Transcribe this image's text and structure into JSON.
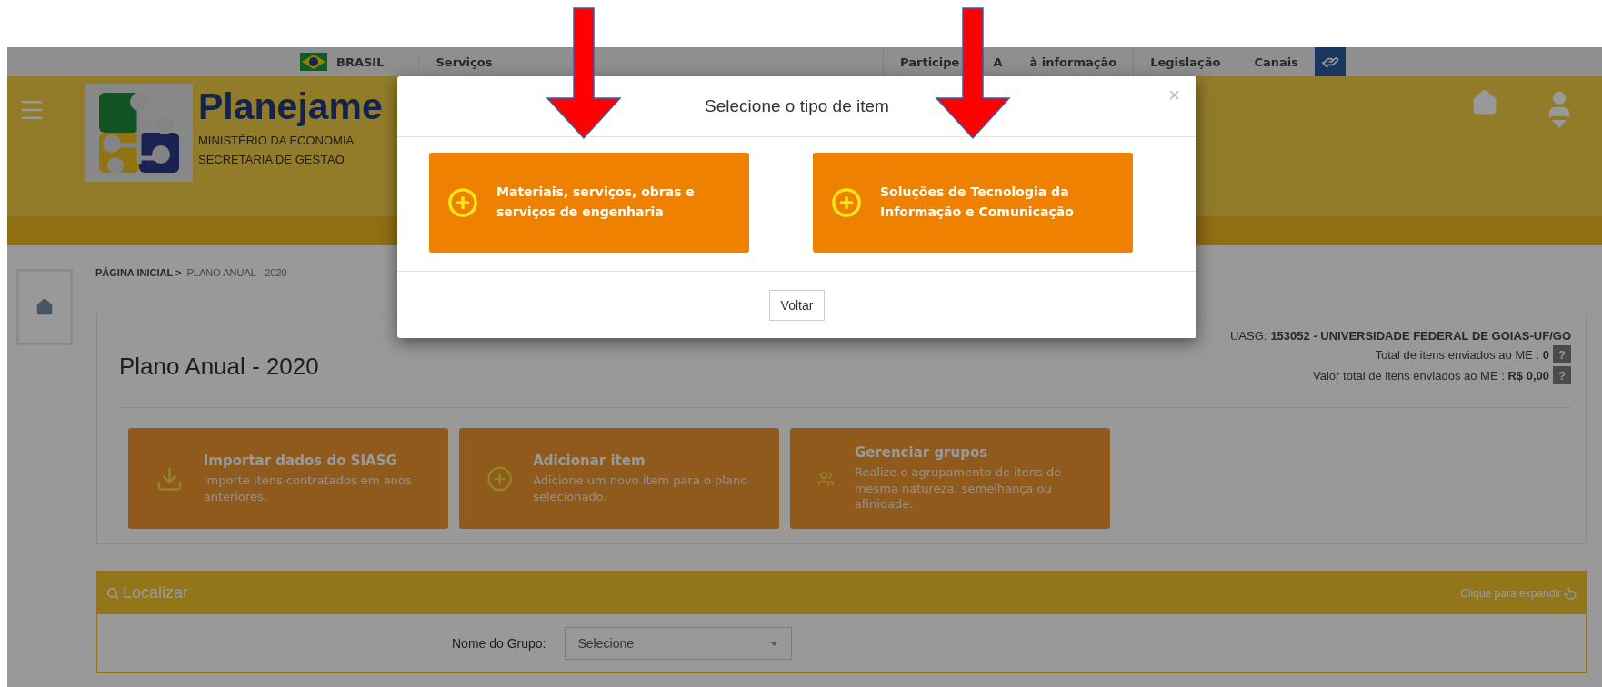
{
  "gov_bar": {
    "country": "BRASIL",
    "left_links": [
      "Serviços"
    ],
    "right_links": [
      {
        "parts": [
          "Participe"
        ]
      },
      {
        "parts": [
          "A",
          "à informação"
        ]
      },
      {
        "parts": [
          "Legislação"
        ]
      },
      {
        "parts": [
          "Canais"
        ]
      }
    ]
  },
  "header": {
    "title": "Planejame",
    "subtitle_lines": [
      "MINISTÉRIO DA ECONOMIA",
      "SECRETARIA DE GESTÃO"
    ]
  },
  "breadcrumb": [
    {
      "label": "PÁGINA INICIAL >",
      "current": false
    },
    {
      "label": "PLANO ANUAL - 2020",
      "current": true
    }
  ],
  "page_title": "Plano Anual - 2020",
  "info": {
    "uasg_label": "UASG:",
    "uasg_value": "153052 - UNIVERSIDADE FEDERAL DE GOIAS-UF/GO",
    "rows": [
      {
        "label": "Total de itens enviados ao ME :",
        "value": "0",
        "help": "?"
      },
      {
        "label": "Valor total de itens enviados ao ME :",
        "value": "R$ 0,00",
        "help": "?"
      }
    ]
  },
  "actions": [
    {
      "kind": "import",
      "title": "Importar dados do SIASG",
      "description": "Importe itens contratados em anos anteriores."
    },
    {
      "kind": "add",
      "title": "Adicionar item",
      "description": "Adicione um novo item para o plano selecionado."
    },
    {
      "kind": "groups",
      "title": "Gerenciar grupos",
      "description": "Realize o agrupamento de itens de mesma natureza, semelhança ou afinidade."
    }
  ],
  "search_panel": {
    "title": "Localizar",
    "hint": "Clique para expandir",
    "fields": [
      {
        "label": "Nome do Grupo:",
        "value": "Selecione"
      }
    ]
  },
  "modal": {
    "title": "Selecione o tipo de item",
    "close": "×",
    "options": [
      {
        "label": "Materiais, serviços, obras e serviços de engenharia"
      },
      {
        "label": "Soluções de Tecnologia da Informação e Comunicação"
      }
    ],
    "back_button": "Voltar"
  }
}
